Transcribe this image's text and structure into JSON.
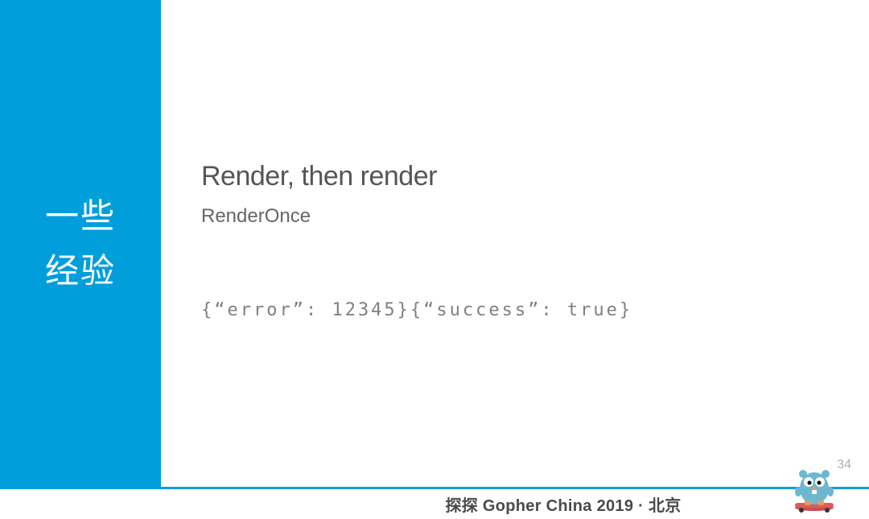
{
  "sidebar": {
    "title_line1": "一些",
    "title_line2": "经验"
  },
  "content": {
    "heading": "Render, then render",
    "subheading": "RenderOnce",
    "code": "{“error”: 12345}{“success”: true}"
  },
  "page": {
    "number": "34"
  },
  "footer": {
    "text": "探探 Gopher China 2019 · 北京"
  }
}
